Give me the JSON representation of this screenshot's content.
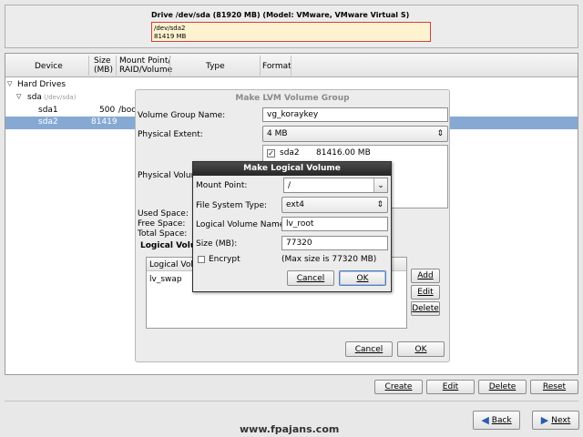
{
  "drive_panel": {
    "title": "Drive /dev/sda (81920 MB) (Model: VMware, VMware Virtual S)",
    "partition_name": "/dev/sda2",
    "partition_size": "81419 MB"
  },
  "table": {
    "headers": {
      "device": "Device",
      "size": "Size\n(MB)",
      "mount": "Mount Point/\nRAID/Volume",
      "type": "Type",
      "format": "Format"
    },
    "rows": {
      "hard_drives": "Hard Drives",
      "sda": "sda",
      "sda_path": "(/dev/sda)",
      "sda1": "sda1",
      "sda1_size": "500",
      "sda1_mount": "/boo",
      "sda2": "sda2",
      "sda2_size": "81419"
    }
  },
  "lvm_dialog": {
    "title": "Make LVM Volume Group",
    "vg_name_label": "Volume Group Name:",
    "vg_name_value": "vg_koraykey",
    "pe_label": "Physical Extent:",
    "pe_value": "4 MB",
    "pv_label": "Physical Volum",
    "pv_item_name": "sda2",
    "pv_item_size": "81416.00 MB",
    "used_space": "Used Space:",
    "free_space": "Free Space:",
    "total_space": "Total Space:",
    "lv_section": "Logical Volu",
    "lv_column": "Logical Volu",
    "lv_item": "lv_swap",
    "add": "Add",
    "edit": "Edit",
    "delete": "Delete",
    "cancel": "Cancel",
    "ok": "OK"
  },
  "lv_dialog": {
    "title": "Make Logical Volume",
    "mount_label": "Mount Point:",
    "mount_value": "/",
    "fs_label": "File System Type:",
    "fs_value": "ext4",
    "lv_name_label": "Logical Volume Name:",
    "lv_name_value": "lv_root",
    "size_label": "Size (MB):",
    "size_value": "77320",
    "encrypt_label": "Encrypt",
    "max_size": "(Max size is 77320 MB)",
    "cancel": "Cancel",
    "ok": "OK"
  },
  "bottom_buttons": {
    "create": "Create",
    "edit": "Edit",
    "delete": "Delete",
    "reset": "Reset"
  },
  "nav": {
    "back": "Back",
    "next": "Next"
  },
  "watermark": "www.fpajans.com",
  "colors": {
    "selection": "#86a9d4",
    "partition_bg": "#fdf3d0",
    "partition_border": "#d04040"
  }
}
